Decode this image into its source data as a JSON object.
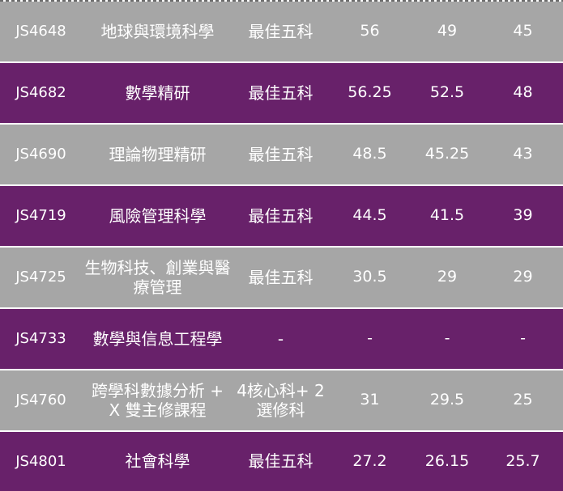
{
  "rows": [
    {
      "code": "JS4648",
      "programme": "地球與環境科學",
      "scoring": "最佳五科",
      "upper_quartile": "56",
      "median": "49",
      "lower_quartile": "45"
    },
    {
      "code": "JS4682",
      "programme": "數學精研",
      "scoring": "最佳五科",
      "upper_quartile": "56.25",
      "median": "52.5",
      "lower_quartile": "48"
    },
    {
      "code": "JS4690",
      "programme": "理論物理精研",
      "scoring": "最佳五科",
      "upper_quartile": "48.5",
      "median": "45.25",
      "lower_quartile": "43"
    },
    {
      "code": "JS4719",
      "programme": "風險管理科學",
      "scoring": "最佳五科",
      "upper_quartile": "44.5",
      "median": "41.5",
      "lower_quartile": "39"
    },
    {
      "code": "JS4725",
      "programme": "生物科技、創業與醫療管理",
      "scoring": "最佳五科",
      "upper_quartile": "30.5",
      "median": "29",
      "lower_quartile": "29"
    },
    {
      "code": "JS4733",
      "programme": "數學與信息工程學",
      "scoring": "-",
      "upper_quartile": "-",
      "median": "-",
      "lower_quartile": "-"
    },
    {
      "code": "JS4760",
      "programme": "跨學科數據分析 + X 雙主修課程",
      "scoring": "4核心科+ 2 選修科",
      "upper_quartile": "31",
      "median": "29.5",
      "lower_quartile": "25"
    },
    {
      "code": "JS4801",
      "programme": "社會科學",
      "scoring": "最佳五科",
      "upper_quartile": "27.2",
      "median": "26.15",
      "lower_quartile": "25.7"
    }
  ],
  "colors": {
    "gray_row": "#a6a6a6",
    "purple_row": "#68216a",
    "text": "#ffffff"
  }
}
